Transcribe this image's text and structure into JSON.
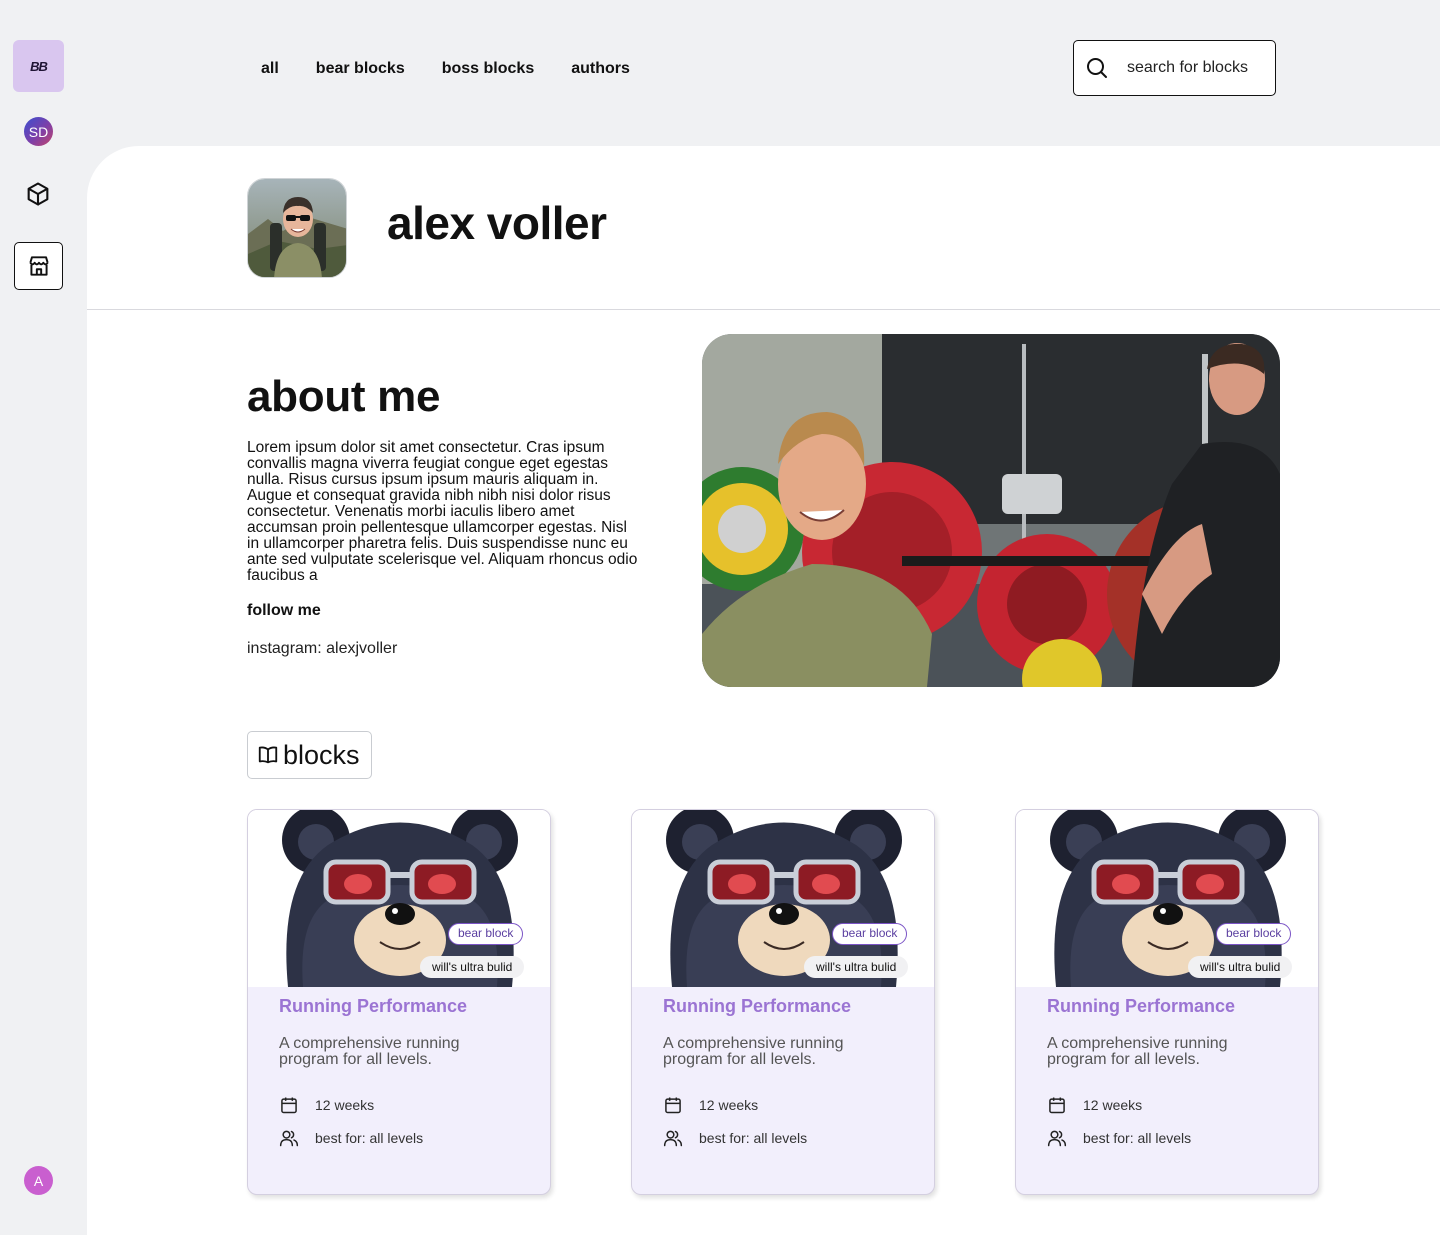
{
  "sidebar": {
    "logo_text": "BB",
    "profile_initials": "SD",
    "user_initial": "A",
    "icons": [
      "box-icon",
      "store-icon"
    ]
  },
  "nav": {
    "links": [
      "all",
      "bear blocks",
      "boss blocks",
      "authors"
    ]
  },
  "search": {
    "label": "search for blocks",
    "icon": "search-icon"
  },
  "profile": {
    "name": "alex voller"
  },
  "about": {
    "title": "about me",
    "body": "Lorem ipsum dolor sit amet consectetur. Cras ipsum convallis magna viverra feugiat congue eget egestas nulla. Risus cursus ipsum ipsum mauris aliquam in. Augue et consequat gravida nibh nibh nisi dolor risus consectetur. Venenatis morbi iaculis libero amet accumsan proin pellentesque ullamcorper egestas. Nisl in ullamcorper pharetra felis. Duis suspendisse nunc eu ante sed vulputate scelerisque vel. Aliquam rhoncus odio faucibus a",
    "follow_heading": "follow me",
    "instagram": "instagram: alexjvoller"
  },
  "blocks_section": {
    "label": "blocks",
    "icon": "book-icon"
  },
  "cards": [
    {
      "tag_type": "bear block",
      "tag_build": "will's ultra bulid",
      "title": "Running Performance",
      "description": "A comprehensive running program for all levels.",
      "duration": "12 weeks",
      "audience": "best for: all levels"
    },
    {
      "tag_type": "bear block",
      "tag_build": "will's ultra bulid",
      "title": "Running Performance",
      "description": "A comprehensive running program for all levels.",
      "duration": "12 weeks",
      "audience": "best for: all levels"
    },
    {
      "tag_type": "bear block",
      "tag_build": "will's ultra bulid",
      "title": "Running Performance",
      "description": "A comprehensive running program for all levels.",
      "duration": "12 weeks",
      "audience": "best for: all levels"
    }
  ],
  "colors": {
    "page_bg": "#f0f1f3",
    "accent_purple": "#9b74d3",
    "card_bg": "#f2effc",
    "logo_bg": "#d9c6ef"
  }
}
